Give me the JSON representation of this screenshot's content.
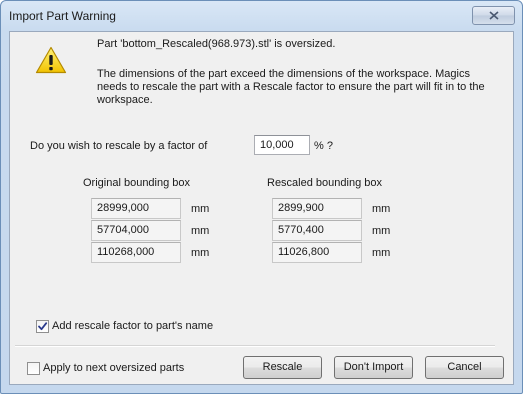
{
  "window": {
    "title": "Import Part Warning"
  },
  "message": {
    "line1": "Part 'bottom_Rescaled(968.973).stl' is oversized.",
    "line2": "The dimensions of the part exceed the dimensions of the workspace. Magics needs to rescale the part with a Rescale factor to ensure the part will fit in to the workspace."
  },
  "rescale": {
    "question": "Do you wish to rescale by a factor of",
    "factor_value": "10,000",
    "factor_unit": "% ?"
  },
  "original": {
    "header": "Original bounding box",
    "values": [
      "28999,000",
      "57704,000",
      "110268,000"
    ],
    "unit": "mm"
  },
  "rescaled": {
    "header": "Rescaled bounding box",
    "values": [
      "2899,900",
      "5770,400",
      "11026,800"
    ],
    "unit": "mm"
  },
  "options": {
    "add_factor_label": "Add rescale factor to part's name",
    "add_factor_checked": true,
    "apply_next_label": "Apply to next oversized parts",
    "apply_next_checked": false
  },
  "buttons": {
    "rescale": "Rescale",
    "dont_import": "Don't Import",
    "cancel": "Cancel"
  },
  "icons": {
    "close": "close-icon",
    "warning": "warning-icon",
    "check": "checkmark-icon"
  }
}
